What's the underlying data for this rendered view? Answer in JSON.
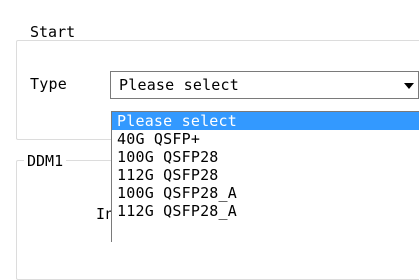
{
  "start_group": {
    "title": "Start"
  },
  "type_row": {
    "label": "Type",
    "combo_value": "Please select"
  },
  "dropdown": {
    "options": [
      "Please select",
      "40G QSFP+",
      "100G QSFP28",
      "112G QSFP28",
      "100G QSFP28_A",
      "112G QSFP28_A"
    ],
    "selected_index": 0
  },
  "ddm_group": {
    "title": "DDM1",
    "partial_label": "In"
  },
  "colors": {
    "selection_bg": "#3399ff",
    "selection_fg": "#ffffff",
    "groupbox_border": "#dcdcdc",
    "combo_border": "#7a7a7a"
  }
}
